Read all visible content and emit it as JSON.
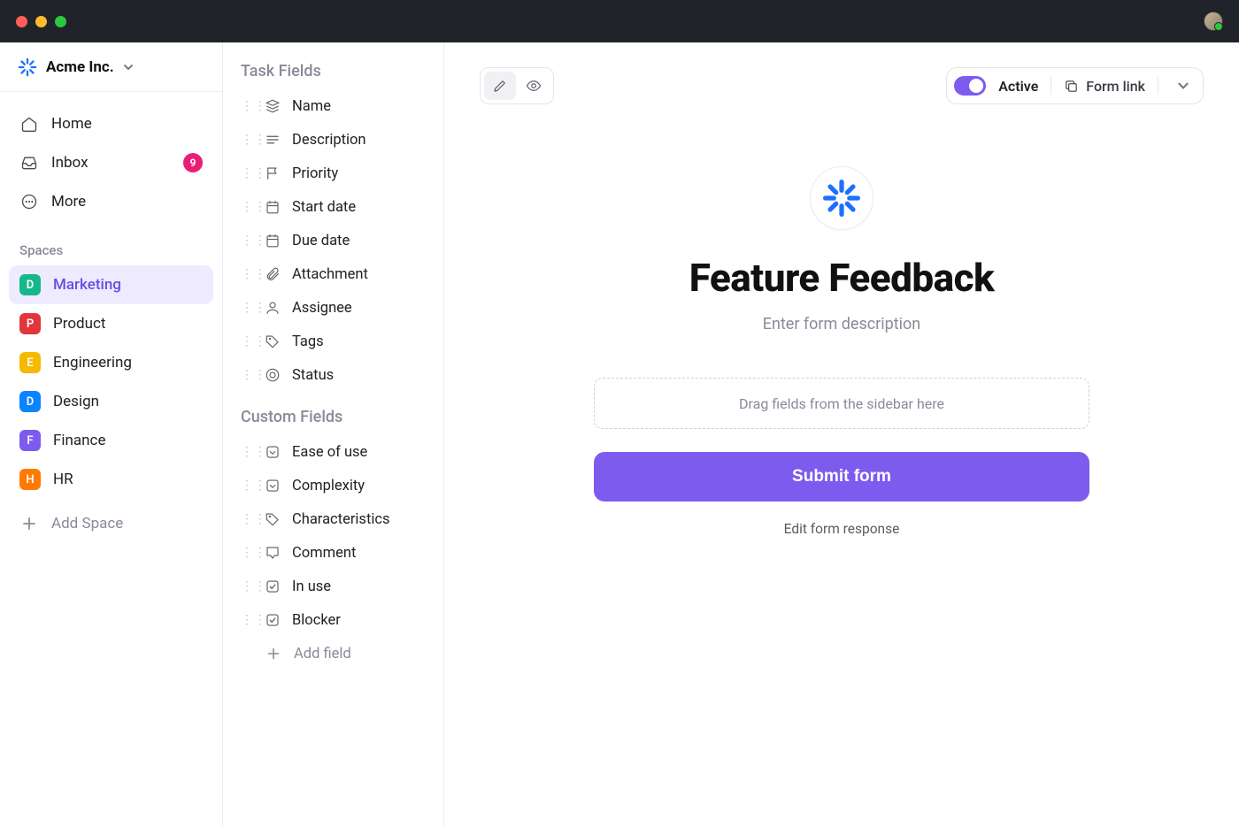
{
  "workspace": {
    "name": "Acme Inc."
  },
  "nav": {
    "home": "Home",
    "inbox": "Inbox",
    "inbox_badge": "9",
    "more": "More"
  },
  "spaces_label": "Spaces",
  "spaces": [
    {
      "letter": "D",
      "label": "Marketing",
      "bg": "#14b88a",
      "active": true
    },
    {
      "letter": "P",
      "label": "Product",
      "bg": "#e0363c",
      "active": false
    },
    {
      "letter": "E",
      "label": "Engineering",
      "bg": "#f5b900",
      "active": false
    },
    {
      "letter": "D",
      "label": "Design",
      "bg": "#0a84ff",
      "active": false
    },
    {
      "letter": "F",
      "label": "Finance",
      "bg": "#7e5bef",
      "active": false
    },
    {
      "letter": "H",
      "label": "HR",
      "bg": "#ff7a00",
      "active": false
    }
  ],
  "add_space": "Add Space",
  "task_fields_heading": "Task Fields",
  "task_fields": [
    {
      "icon": "stack",
      "label": "Name"
    },
    {
      "icon": "lines",
      "label": "Description"
    },
    {
      "icon": "flag",
      "label": "Priority"
    },
    {
      "icon": "calendar",
      "label": "Start date"
    },
    {
      "icon": "calendar",
      "label": "Due date"
    },
    {
      "icon": "paperclip",
      "label": "Attachment"
    },
    {
      "icon": "person",
      "label": "Assignee"
    },
    {
      "icon": "tag",
      "label": "Tags"
    },
    {
      "icon": "target",
      "label": "Status"
    }
  ],
  "custom_fields_heading": "Custom Fields",
  "custom_fields": [
    {
      "icon": "select",
      "label": "Ease of use"
    },
    {
      "icon": "select",
      "label": "Complexity"
    },
    {
      "icon": "tag",
      "label": "Characteristics"
    },
    {
      "icon": "comment",
      "label": "Comment"
    },
    {
      "icon": "checkbox",
      "label": "In use"
    },
    {
      "icon": "checkbox",
      "label": "Blocker"
    }
  ],
  "add_field": "Add field",
  "toolbar": {
    "active_label": "Active",
    "form_link_label": "Form link"
  },
  "form": {
    "title": "Feature Feedback",
    "description_placeholder": "Enter form description",
    "dropzone_hint": "Drag fields from the sidebar here",
    "submit_label": "Submit form",
    "edit_response_label": "Edit form response"
  }
}
